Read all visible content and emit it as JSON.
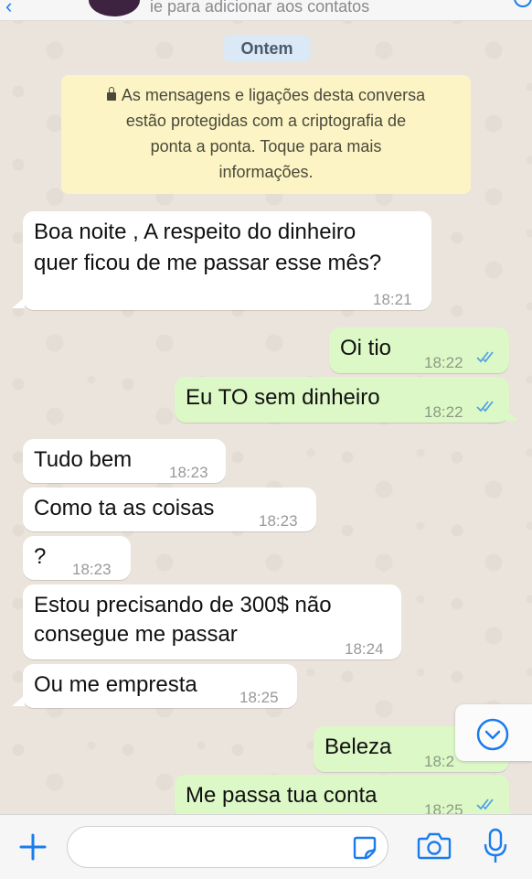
{
  "header": {
    "subtitle": "ie para adicionar aos contatos"
  },
  "date_chip": "Ontem",
  "notice": {
    "lines": [
      "As mensagens e ligações desta conversa",
      "estão protegidas com a criptografia de",
      "ponta a ponta. Toque para mais",
      "informações."
    ]
  },
  "messages": [
    {
      "dir": "in",
      "lines": [
        "Boa noite , A respeito do dinheiro",
        "quer ficou de me passar esse mês?"
      ],
      "time": "18:21"
    },
    {
      "dir": "out",
      "text": "Oi tio",
      "time": "18:22"
    },
    {
      "dir": "out",
      "text": "Eu TO sem dinheiro",
      "time": "18:22"
    },
    {
      "dir": "in",
      "text": "Tudo bem",
      "time": "18:23"
    },
    {
      "dir": "in",
      "text": "Como ta as coisas",
      "time": "18:23"
    },
    {
      "dir": "in",
      "text": "?",
      "time": "18:23"
    },
    {
      "dir": "in",
      "lines": [
        "Estou precisando de 300$ não",
        "consegue me passar"
      ],
      "time": "18:24"
    },
    {
      "dir": "in",
      "text": "Ou me empresta",
      "time": "18:25"
    },
    {
      "dir": "out",
      "text": "Beleza",
      "time": "18:2"
    },
    {
      "dir": "out",
      "text": "Me passa tua conta",
      "time": "18:25"
    }
  ],
  "colors": {
    "incoming_bubble": "#ffffff",
    "outgoing_bubble": "#dcf8c6",
    "read_ticks": "#4fa3e6",
    "accent": "#1b7ced"
  },
  "icons": {
    "add": "plus-icon",
    "sticker": "sticker-icon",
    "camera": "camera-icon",
    "mic": "microphone-icon",
    "scroll": "chevron-down-icon"
  }
}
